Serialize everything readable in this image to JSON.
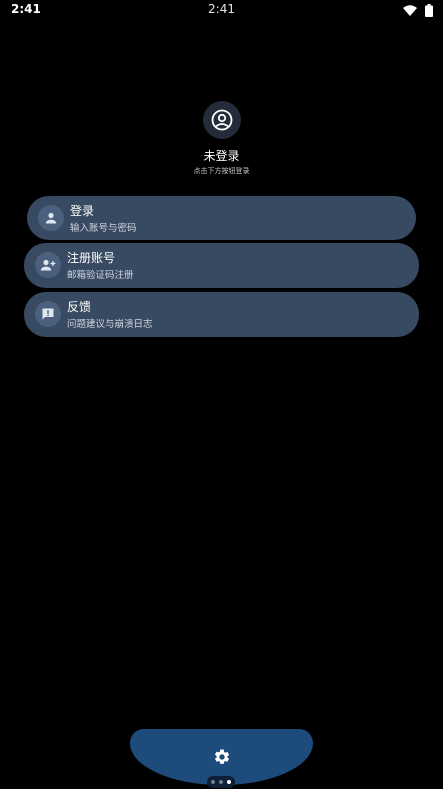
{
  "status_bar": {
    "time_left": "2:41",
    "time_center": "2:41"
  },
  "profile": {
    "name": "未登录",
    "hint": "点击下方按钮登录"
  },
  "menu": {
    "login": {
      "title": "登录",
      "subtitle": "输入账号与密码",
      "icon": "person-icon"
    },
    "register": {
      "title": "注册账号",
      "subtitle": "邮箱验证码注册",
      "icon": "person-add-icon"
    },
    "feedback": {
      "title": "反馈",
      "subtitle": "问题建议与崩溃日志",
      "icon": "feedback-icon"
    }
  },
  "dock": {
    "settings_icon": "gear-icon",
    "page_indicator": {
      "count": 3,
      "active": 3
    }
  },
  "colors": {
    "background": "#000000",
    "card": "#374a62",
    "card_icon_bg": "#4a607d",
    "dock": "#1c4b7c"
  }
}
